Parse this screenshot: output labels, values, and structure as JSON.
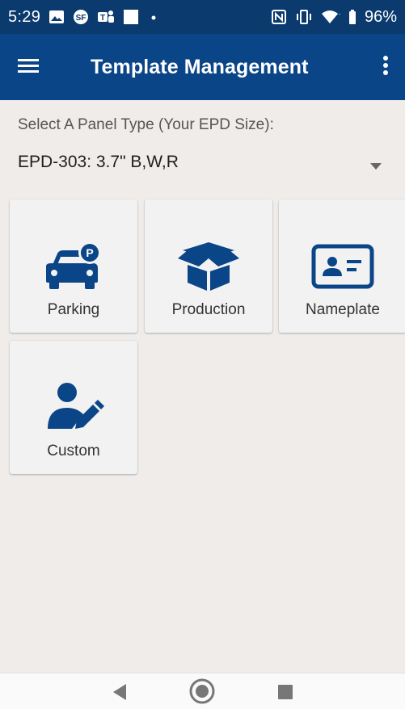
{
  "status_bar": {
    "time": "5:29",
    "battery": "96%",
    "icons": [
      "image-icon",
      "sf-icon",
      "teams-icon",
      "square-icon",
      "dot-icon",
      "nfc-icon",
      "vibrate-icon",
      "wifi-icon",
      "battery-icon"
    ]
  },
  "app_bar": {
    "title": "Template Management",
    "menu_icon": "hamburger-menu-icon",
    "overflow_icon": "more-vert-icon",
    "color": "#0a4587"
  },
  "panel_selector": {
    "label": "Select A Panel Type (Your EPD Size):",
    "selected": "EPD-303: 3.7\" B,W,R"
  },
  "templates": [
    {
      "label": "Parking",
      "icon": "parking-car-icon"
    },
    {
      "label": "Production",
      "icon": "box-icon"
    },
    {
      "label": "Nameplate",
      "icon": "id-card-icon"
    },
    {
      "label": "Custom",
      "icon": "user-edit-icon"
    }
  ],
  "nav_bar": {
    "back": "back-icon",
    "home": "home-icon",
    "recents": "recents-icon"
  },
  "colors": {
    "primary": "#0a4587",
    "status_bar": "#0a3a6e",
    "background": "#efece9"
  }
}
